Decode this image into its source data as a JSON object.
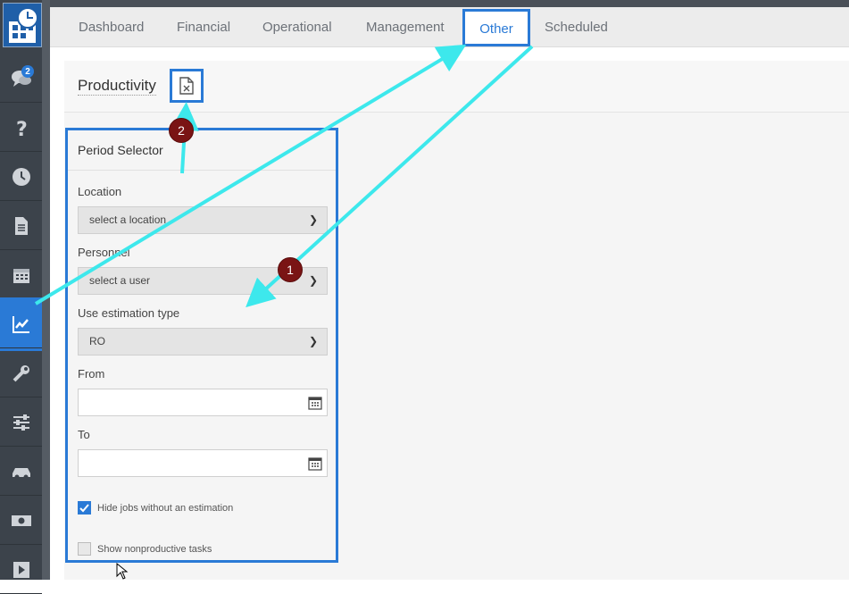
{
  "sidebar": {
    "chat_badge": "2",
    "items": [
      {
        "icon": "chat-icon"
      },
      {
        "icon": "help-icon"
      },
      {
        "icon": "clock-icon"
      },
      {
        "icon": "document-icon"
      },
      {
        "icon": "calendar-icon"
      },
      {
        "icon": "chart-icon",
        "active": true
      },
      {
        "icon": "wrench-icon"
      },
      {
        "icon": "sliders-icon"
      },
      {
        "icon": "car-icon"
      },
      {
        "icon": "money-icon"
      },
      {
        "icon": "play-icon"
      }
    ]
  },
  "tabs": [
    "Dashboard",
    "Financial",
    "Operational",
    "Management",
    "Other",
    "Scheduled"
  ],
  "active_tab": "Other",
  "page": {
    "title": "Productivity"
  },
  "panel": {
    "title": "Period Selector",
    "location_label": "Location",
    "location_value": "select a location",
    "personnel_label": "Personnel",
    "personnel_value": "select a user",
    "estimation_label": "Use estimation type",
    "estimation_value": "RO",
    "from_label": "From",
    "to_label": "To",
    "hide_jobs_label": "Hide jobs without an estimation",
    "hide_jobs_checked": true,
    "show_nonproductive_label": "Show nonproductive tasks",
    "show_nonproductive_checked": false
  },
  "callouts": [
    "1",
    "2"
  ],
  "colors": {
    "accent": "#2a7ad6",
    "sidebar": "#3c434b",
    "arrow": "#3de8ec",
    "callout": "#7a1414"
  }
}
